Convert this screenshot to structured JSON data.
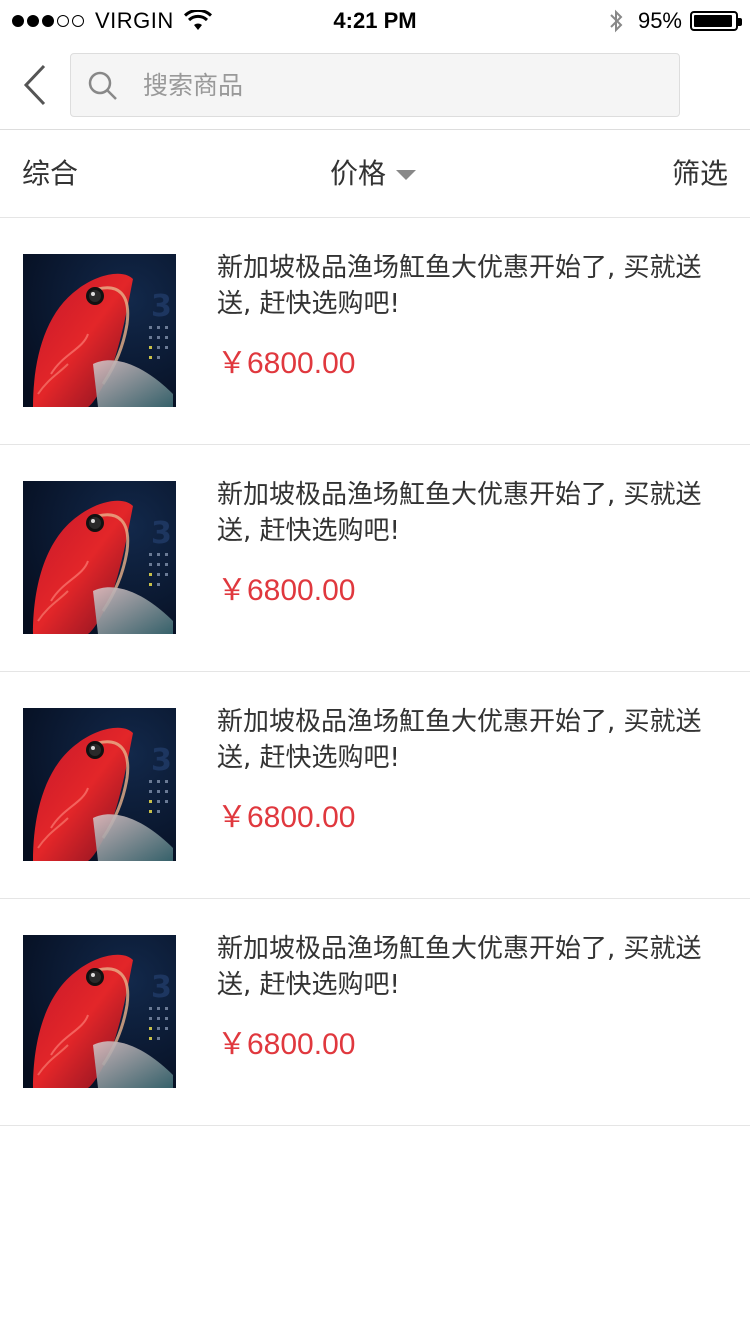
{
  "status_bar": {
    "carrier": "VIRGIN",
    "time": "4:21 PM",
    "battery": "95%",
    "battery_level": 0.95,
    "signal_bars": 3,
    "signal_total": 5
  },
  "header": {
    "search": {
      "placeholder": "搜索商品",
      "value": ""
    }
  },
  "sort_bar": {
    "zonghe": "综合",
    "price": "价格",
    "filter": "筛选"
  },
  "products": [
    {
      "title": "新加坡极品渔场魟鱼大优惠开始了, 买就送送, 赶快选购吧!",
      "price": "￥6800.00"
    },
    {
      "title": "新加坡极品渔场魟鱼大优惠开始了, 买就送送, 赶快选购吧!",
      "price": "￥6800.00"
    },
    {
      "title": "新加坡极品渔场魟鱼大优惠开始了, 买就送送, 赶快选购吧!",
      "price": "￥6800.00"
    },
    {
      "title": "新加坡极品渔场魟鱼大优惠开始了, 买就送送, 赶快选购吧!",
      "price": "￥6800.00"
    }
  ],
  "colors": {
    "price": "#e0383e",
    "divider": "#e5e5e5",
    "text": "#333333"
  }
}
